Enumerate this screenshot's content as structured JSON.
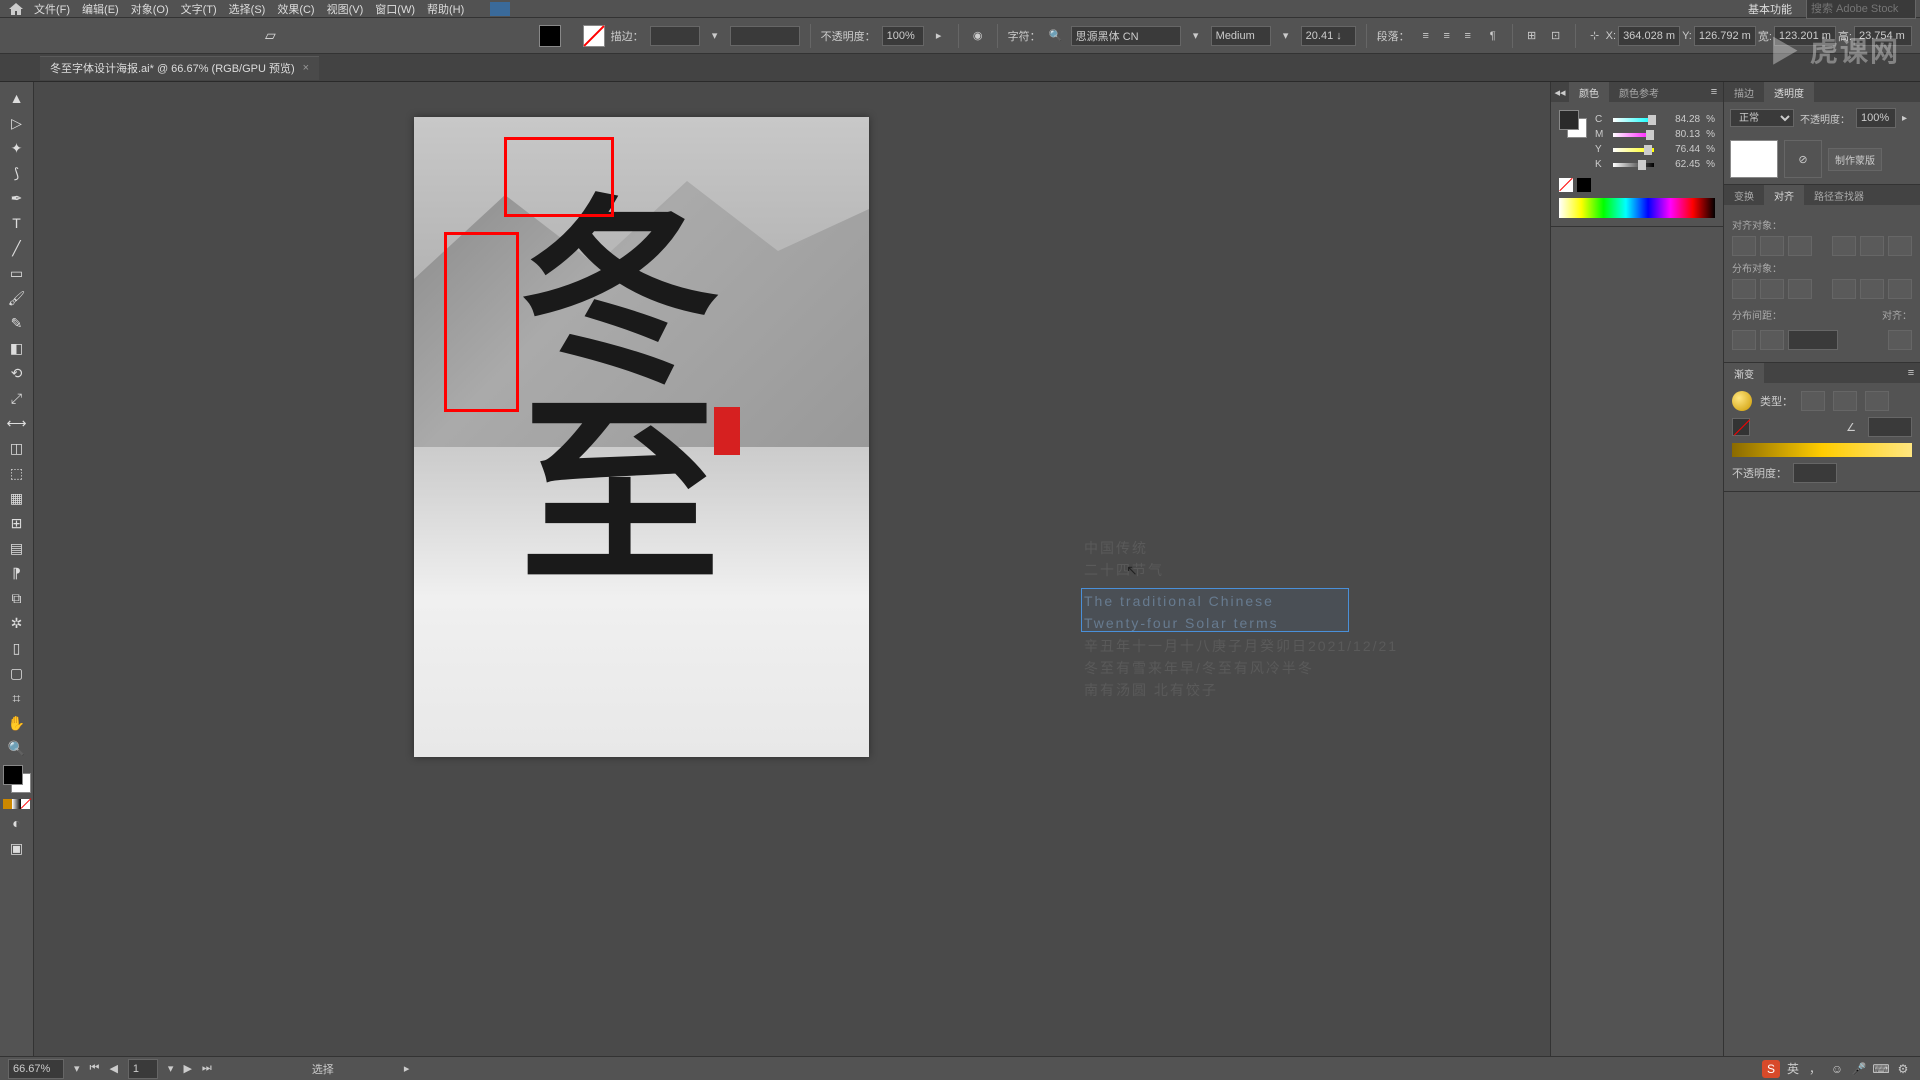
{
  "menubar": {
    "items": [
      "文件(F)",
      "编辑(E)",
      "对象(O)",
      "文字(T)",
      "选择(S)",
      "效果(C)",
      "视图(V)",
      "窗口(W)",
      "帮助(H)"
    ],
    "workspace": "基本功能",
    "stock": "搜索 Adobe Stock"
  },
  "controlbar": {
    "stroke_label": "描边：",
    "stroke_weight": "",
    "opacity_label": "不透明度：",
    "opacity_value": "100%",
    "char_label": "字符：",
    "font": "思源黑体 CN",
    "font_weight": "Medium",
    "font_size": "20.41 ↓",
    "paragraph_label": "段落：",
    "x_label": "X:",
    "x_value": "364.028 m",
    "y_label": "Y:",
    "y_value": "126.792 m",
    "w_label": "宽:",
    "w_value": "123.201 m",
    "h_label": "高:",
    "h_value": "23.754 m"
  },
  "tab": {
    "title": "冬至字体设计海报.ai* @ 66.67% (RGB/GPU 预览)",
    "close": "×"
  },
  "canvas_text": {
    "line1": "中国传统",
    "line2": "二十四节气",
    "line3": "The traditional Chinese",
    "line4": "Twenty-four Solar terms",
    "line5": "辛丑年十一月十八庚子月癸卯日2021/12/21",
    "line6": "冬至有雪来年早/冬至有风冷半冬",
    "line7": "南有汤圆 北有饺子",
    "calligraphy": "冬至"
  },
  "color_panel": {
    "tab1": "颜色",
    "tab2": "颜色参考",
    "c": {
      "label": "C",
      "value": "84.28",
      "pct": 84
    },
    "m": {
      "label": "M",
      "value": "80.13",
      "pct": 80
    },
    "y": {
      "label": "Y",
      "value": "76.44",
      "pct": 76
    },
    "k": {
      "label": "K",
      "value": "62.45",
      "pct": 62
    }
  },
  "align_panel": {
    "tab1": "变换",
    "tab2": "对齐",
    "tab3": "路径查找器",
    "section1": "对齐对象：",
    "section2": "分布对象：",
    "section3": "分布间距：",
    "section3_right": "对齐："
  },
  "transparency_panel": {
    "tab1": "描边",
    "tab2": "透明度",
    "mode": "正常",
    "opacity_label": "不透明度：",
    "opacity_value": "100%",
    "make_mask": "制作蒙版"
  },
  "gradient_panel": {
    "tab": "渐变",
    "type_label": "类型：",
    "opacity_label": "不透明度："
  },
  "statusbar": {
    "zoom": "66.67%",
    "page": "1",
    "status": "选择",
    "ime": "英"
  },
  "watermark": "虎课网"
}
